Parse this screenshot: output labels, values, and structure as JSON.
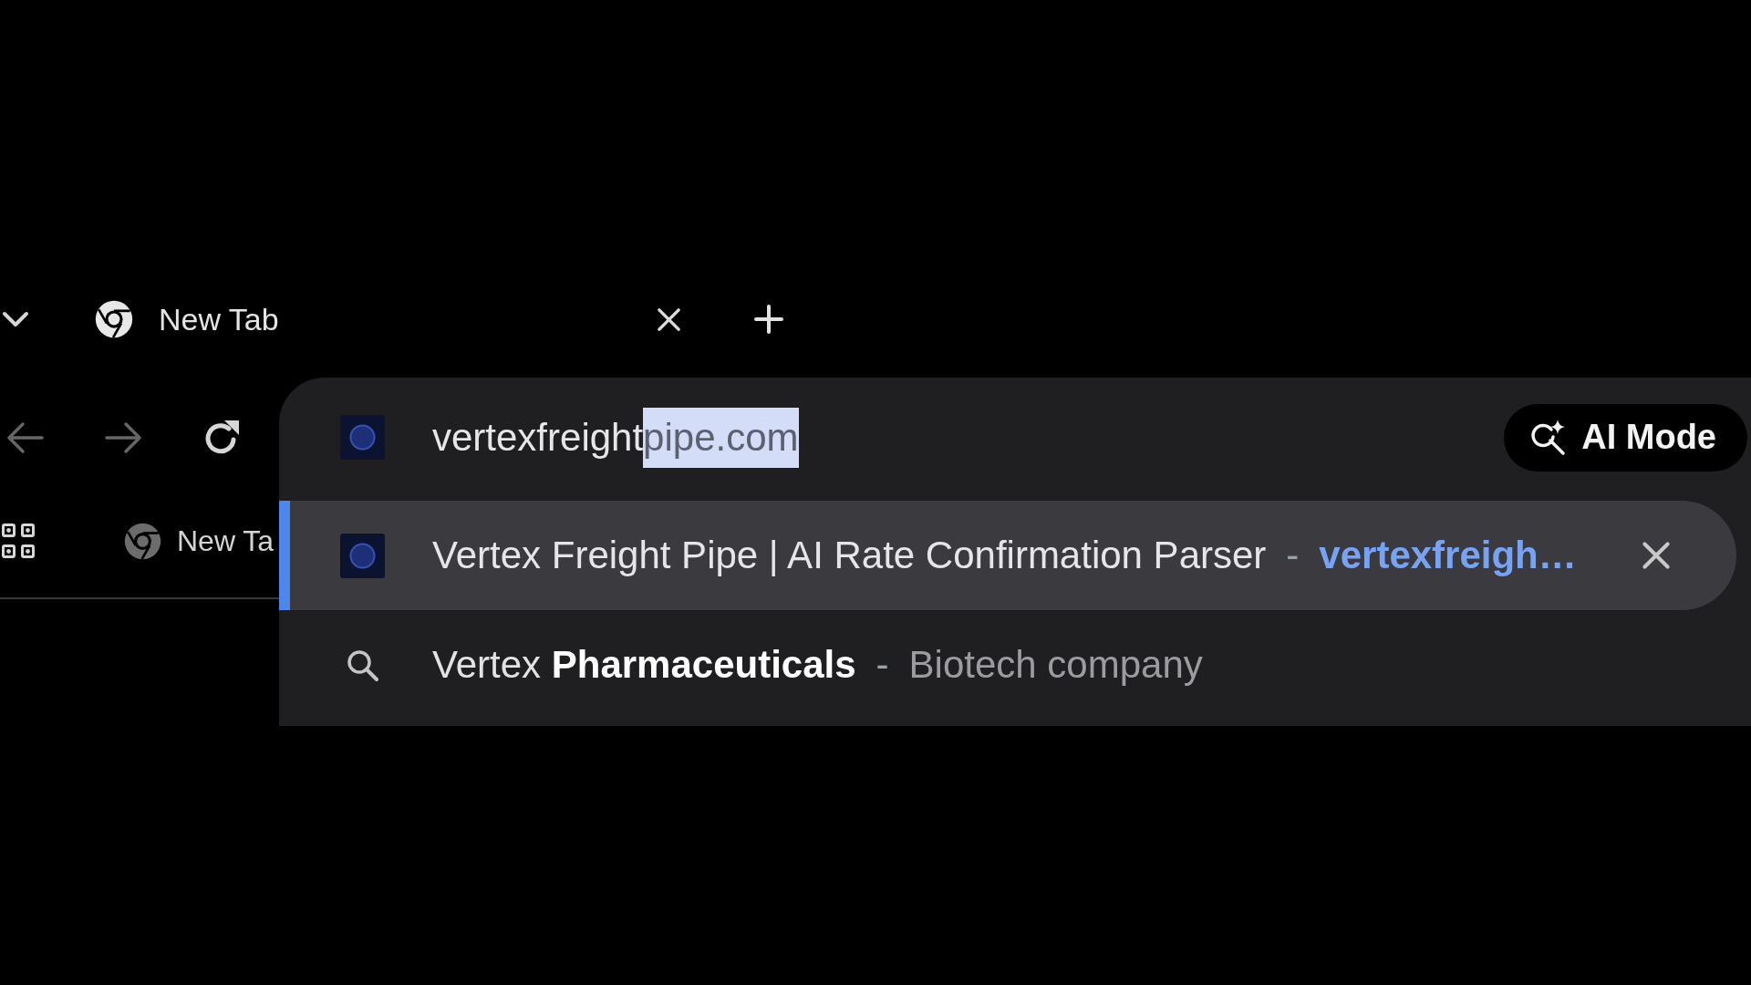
{
  "tab_strip": {
    "tabs": [
      {
        "title": "New Tab",
        "selected": true
      }
    ]
  },
  "toolbar": {
    "buttons": [
      {
        "kind": "back",
        "disabled": true
      },
      {
        "kind": "forward",
        "disabled": true
      },
      {
        "kind": "reload",
        "disabled": false
      }
    ]
  },
  "bookmarks_bar": {
    "items": [
      {
        "kind": "apps"
      },
      {
        "kind": "bookmark",
        "label": "New Ta"
      }
    ]
  },
  "omnibox": {
    "typed_text": "vertexfreight",
    "autocomplete_text": "pipe.com",
    "ai_mode_label": "AI Mode",
    "suggestions": [
      {
        "kind": "site",
        "title": "Vertex Freight Pipe | AI Rate Confirmation Parser",
        "separator": "-",
        "url": "vertexfreigh…",
        "selected": true
      },
      {
        "kind": "search",
        "query": "Vertex **Pharmaceuticals**",
        "separator": "-",
        "description": "Biotech company",
        "selected": false
      }
    ]
  }
}
